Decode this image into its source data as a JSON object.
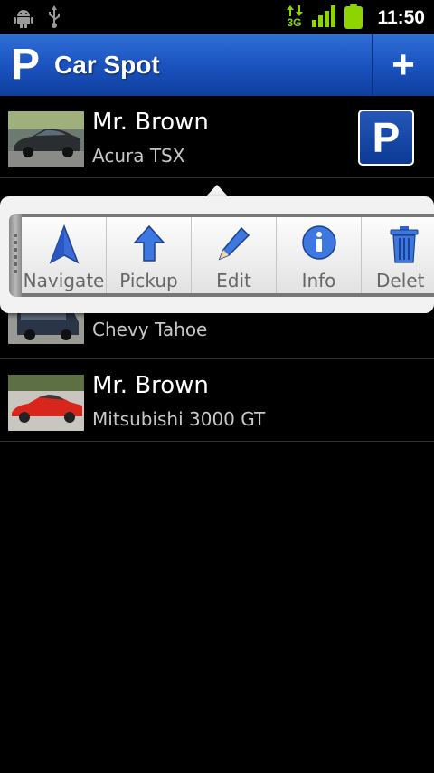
{
  "status_bar": {
    "network_label": "3G",
    "time": "11:50",
    "icons": [
      "android-icon",
      "usb-icon",
      "data-activity-icon",
      "signal-icon",
      "battery-icon"
    ],
    "accent_color": "#8dd400"
  },
  "action_bar": {
    "logo_letter": "P",
    "title": "Car Spot",
    "add_label": "+",
    "color": "#1b53bf"
  },
  "list": {
    "items": [
      {
        "name": "Mr. Brown",
        "car": "Acura TSX",
        "parked_badge": "P"
      },
      {
        "name": "",
        "car": "Chevy Tahoe"
      },
      {
        "name": "Mr. Brown",
        "car": "Mitsubishi 3000 GT"
      }
    ]
  },
  "quick_actions": {
    "items": [
      {
        "label": "Navigate",
        "icon": "navigate-icon"
      },
      {
        "label": "Pickup",
        "icon": "pickup-arrow-icon"
      },
      {
        "label": "Edit",
        "icon": "edit-pencil-icon"
      },
      {
        "label": "Info",
        "icon": "info-icon"
      },
      {
        "label": "Delet",
        "icon": "trash-icon"
      }
    ]
  }
}
